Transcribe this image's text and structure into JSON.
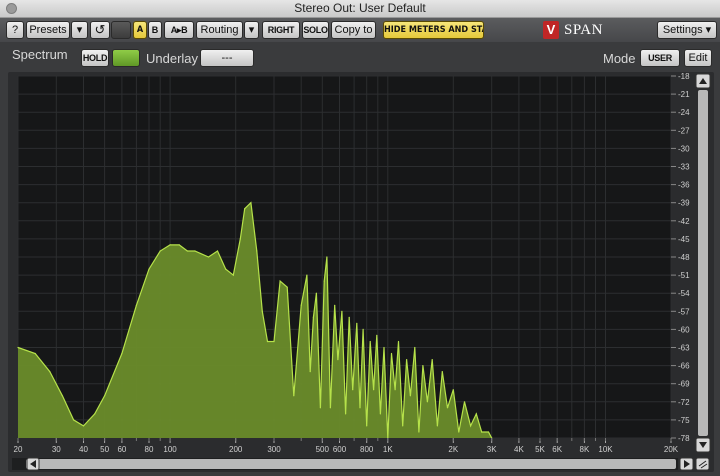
{
  "window": {
    "title": "Stereo Out: User Default"
  },
  "toolbar": {
    "help_label": "?",
    "presets_label": "Presets",
    "dropdown_glyph": "▾",
    "undo_glyph": "↺",
    "a_label": "A",
    "b_label": "B",
    "ab_label": "A▸B",
    "routing_label": "Routing",
    "channel_label": "RIGHT",
    "solo_label": "SOLO",
    "copy_label": "Copy to",
    "hide_meters_label": "HIDE METERS AND STATS",
    "settings_label": "Settings ▾",
    "brand_glyph": "V",
    "brand_name": "SPAN"
  },
  "spectrum_bar": {
    "spectrum_label": "Spectrum",
    "hold_label": "HOLD",
    "underlay_label": "Underlay",
    "underlay_value": "---",
    "mode_label": "Mode",
    "mode_value": "USER",
    "edit_label": "Edit"
  },
  "colors": {
    "spectrum_fill": "#6a8c2a",
    "spectrum_stroke": "#b6e24a",
    "accent_green": "#7fb83a",
    "hide_meters_bg": "#f0d95a"
  },
  "chart_data": {
    "type": "area",
    "xlabel": "",
    "ylabel": "",
    "x_scale": "log",
    "xlim": [
      20,
      20000
    ],
    "ylim": [
      -78,
      -18
    ],
    "x_ticks": [
      "20",
      "30",
      "40",
      "50",
      "60",
      "80",
      "100",
      "200",
      "300",
      "500",
      "600",
      "800",
      "1K",
      "2K",
      "3K",
      "4K",
      "5K",
      "6K",
      "8K",
      "10K",
      "20K"
    ],
    "y_ticks": [
      "-18",
      "-21",
      "-24",
      "-27",
      "-30",
      "-33",
      "-36",
      "-39",
      "-42",
      "-45",
      "-48",
      "-51",
      "-54",
      "-57",
      "-60",
      "-63",
      "-66",
      "-69",
      "-72",
      "-75",
      "-78"
    ],
    "grid": true,
    "series": [
      {
        "x": [
          20,
          24,
          28,
          32,
          36,
          40,
          45,
          50,
          60,
          70,
          80,
          90,
          100,
          110,
          120,
          130,
          150,
          165,
          180,
          195,
          210,
          220,
          235,
          250,
          265,
          280,
          300,
          320,
          345,
          370,
          400,
          425,
          440,
          455,
          470,
          490,
          510,
          525,
          545,
          570,
          590,
          615,
          640,
          665,
          690,
          720,
          745,
          770,
          800,
          830,
          860,
          890,
          925,
          960,
          1000,
          1040,
          1080,
          1120,
          1170,
          1220,
          1270,
          1330,
          1390,
          1450,
          1520,
          1600,
          1690,
          1780,
          1880,
          2000,
          2120,
          2250,
          2400,
          2550,
          2700,
          2900,
          3000
        ],
        "y": [
          -63,
          -64,
          -67,
          -71,
          -75,
          -76,
          -74,
          -71,
          -64,
          -56,
          -50,
          -47,
          -46,
          -46,
          -47,
          -47,
          -48,
          -47,
          -50,
          -51,
          -45,
          -40,
          -39,
          -47,
          -57,
          -62,
          -62,
          -52,
          -53,
          -71,
          -56,
          -51,
          -67,
          -58,
          -54,
          -73,
          -52,
          -48,
          -73,
          -56,
          -65,
          -57,
          -74,
          -58,
          -70,
          -59,
          -73,
          -60,
          -76,
          -62,
          -70,
          -61,
          -74,
          -63,
          -78,
          -64,
          -70,
          -62,
          -76,
          -65,
          -71,
          -63,
          -77,
          -66,
          -72,
          -65,
          -76,
          -67,
          -73,
          -70,
          -77,
          -72,
          -76,
          -74,
          -77,
          -77,
          -78
        ]
      }
    ]
  }
}
